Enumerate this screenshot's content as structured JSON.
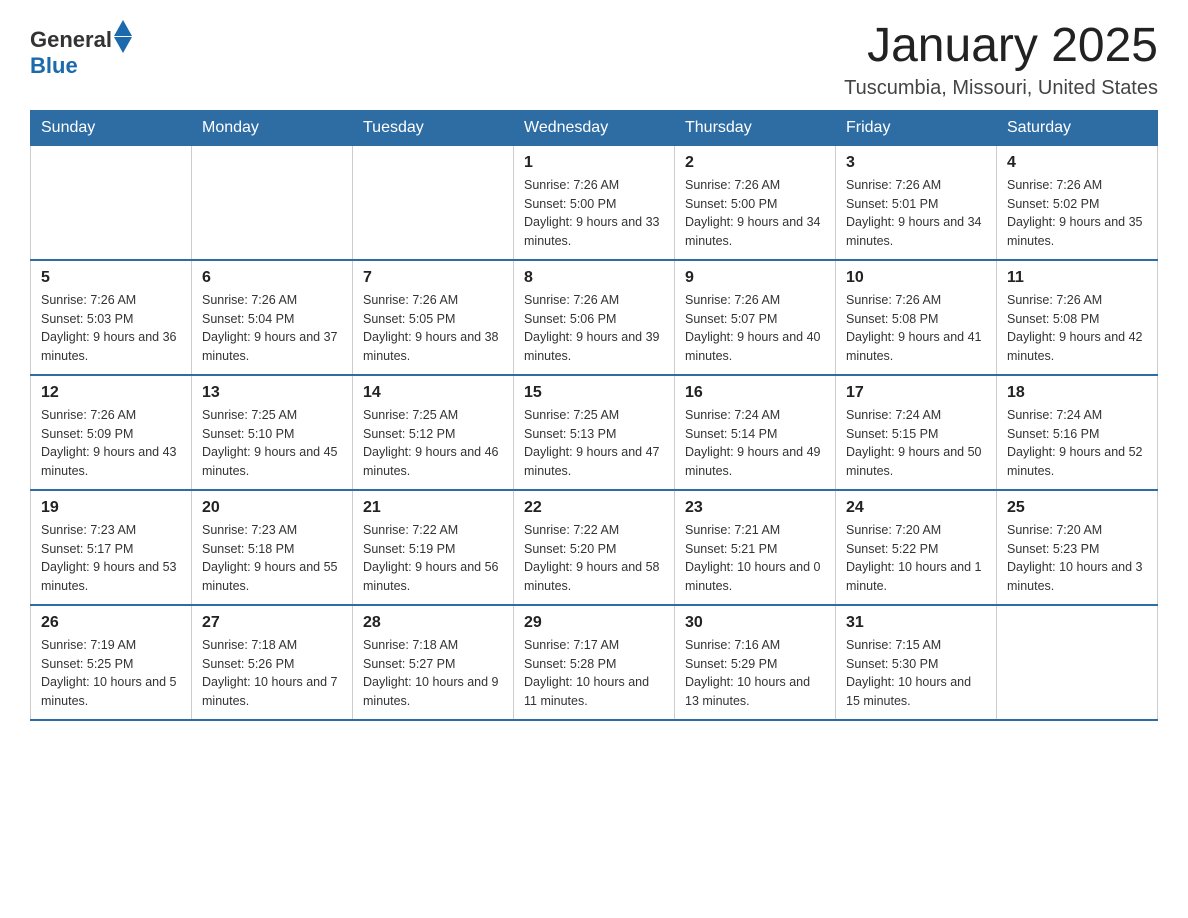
{
  "logo": {
    "text_general": "General",
    "text_blue": "Blue"
  },
  "title": "January 2025",
  "subtitle": "Tuscumbia, Missouri, United States",
  "days_of_week": [
    "Sunday",
    "Monday",
    "Tuesday",
    "Wednesday",
    "Thursday",
    "Friday",
    "Saturday"
  ],
  "weeks": [
    [
      {
        "day": "",
        "info": ""
      },
      {
        "day": "",
        "info": ""
      },
      {
        "day": "",
        "info": ""
      },
      {
        "day": "1",
        "info": "Sunrise: 7:26 AM\nSunset: 5:00 PM\nDaylight: 9 hours\nand 33 minutes."
      },
      {
        "day": "2",
        "info": "Sunrise: 7:26 AM\nSunset: 5:00 PM\nDaylight: 9 hours\nand 34 minutes."
      },
      {
        "day": "3",
        "info": "Sunrise: 7:26 AM\nSunset: 5:01 PM\nDaylight: 9 hours\nand 34 minutes."
      },
      {
        "day": "4",
        "info": "Sunrise: 7:26 AM\nSunset: 5:02 PM\nDaylight: 9 hours\nand 35 minutes."
      }
    ],
    [
      {
        "day": "5",
        "info": "Sunrise: 7:26 AM\nSunset: 5:03 PM\nDaylight: 9 hours\nand 36 minutes."
      },
      {
        "day": "6",
        "info": "Sunrise: 7:26 AM\nSunset: 5:04 PM\nDaylight: 9 hours\nand 37 minutes."
      },
      {
        "day": "7",
        "info": "Sunrise: 7:26 AM\nSunset: 5:05 PM\nDaylight: 9 hours\nand 38 minutes."
      },
      {
        "day": "8",
        "info": "Sunrise: 7:26 AM\nSunset: 5:06 PM\nDaylight: 9 hours\nand 39 minutes."
      },
      {
        "day": "9",
        "info": "Sunrise: 7:26 AM\nSunset: 5:07 PM\nDaylight: 9 hours\nand 40 minutes."
      },
      {
        "day": "10",
        "info": "Sunrise: 7:26 AM\nSunset: 5:08 PM\nDaylight: 9 hours\nand 41 minutes."
      },
      {
        "day": "11",
        "info": "Sunrise: 7:26 AM\nSunset: 5:08 PM\nDaylight: 9 hours\nand 42 minutes."
      }
    ],
    [
      {
        "day": "12",
        "info": "Sunrise: 7:26 AM\nSunset: 5:09 PM\nDaylight: 9 hours\nand 43 minutes."
      },
      {
        "day": "13",
        "info": "Sunrise: 7:25 AM\nSunset: 5:10 PM\nDaylight: 9 hours\nand 45 minutes."
      },
      {
        "day": "14",
        "info": "Sunrise: 7:25 AM\nSunset: 5:12 PM\nDaylight: 9 hours\nand 46 minutes."
      },
      {
        "day": "15",
        "info": "Sunrise: 7:25 AM\nSunset: 5:13 PM\nDaylight: 9 hours\nand 47 minutes."
      },
      {
        "day": "16",
        "info": "Sunrise: 7:24 AM\nSunset: 5:14 PM\nDaylight: 9 hours\nand 49 minutes."
      },
      {
        "day": "17",
        "info": "Sunrise: 7:24 AM\nSunset: 5:15 PM\nDaylight: 9 hours\nand 50 minutes."
      },
      {
        "day": "18",
        "info": "Sunrise: 7:24 AM\nSunset: 5:16 PM\nDaylight: 9 hours\nand 52 minutes."
      }
    ],
    [
      {
        "day": "19",
        "info": "Sunrise: 7:23 AM\nSunset: 5:17 PM\nDaylight: 9 hours\nand 53 minutes."
      },
      {
        "day": "20",
        "info": "Sunrise: 7:23 AM\nSunset: 5:18 PM\nDaylight: 9 hours\nand 55 minutes."
      },
      {
        "day": "21",
        "info": "Sunrise: 7:22 AM\nSunset: 5:19 PM\nDaylight: 9 hours\nand 56 minutes."
      },
      {
        "day": "22",
        "info": "Sunrise: 7:22 AM\nSunset: 5:20 PM\nDaylight: 9 hours\nand 58 minutes."
      },
      {
        "day": "23",
        "info": "Sunrise: 7:21 AM\nSunset: 5:21 PM\nDaylight: 10 hours\nand 0 minutes."
      },
      {
        "day": "24",
        "info": "Sunrise: 7:20 AM\nSunset: 5:22 PM\nDaylight: 10 hours\nand 1 minute."
      },
      {
        "day": "25",
        "info": "Sunrise: 7:20 AM\nSunset: 5:23 PM\nDaylight: 10 hours\nand 3 minutes."
      }
    ],
    [
      {
        "day": "26",
        "info": "Sunrise: 7:19 AM\nSunset: 5:25 PM\nDaylight: 10 hours\nand 5 minutes."
      },
      {
        "day": "27",
        "info": "Sunrise: 7:18 AM\nSunset: 5:26 PM\nDaylight: 10 hours\nand 7 minutes."
      },
      {
        "day": "28",
        "info": "Sunrise: 7:18 AM\nSunset: 5:27 PM\nDaylight: 10 hours\nand 9 minutes."
      },
      {
        "day": "29",
        "info": "Sunrise: 7:17 AM\nSunset: 5:28 PM\nDaylight: 10 hours\nand 11 minutes."
      },
      {
        "day": "30",
        "info": "Sunrise: 7:16 AM\nSunset: 5:29 PM\nDaylight: 10 hours\nand 13 minutes."
      },
      {
        "day": "31",
        "info": "Sunrise: 7:15 AM\nSunset: 5:30 PM\nDaylight: 10 hours\nand 15 minutes."
      },
      {
        "day": "",
        "info": ""
      }
    ]
  ]
}
